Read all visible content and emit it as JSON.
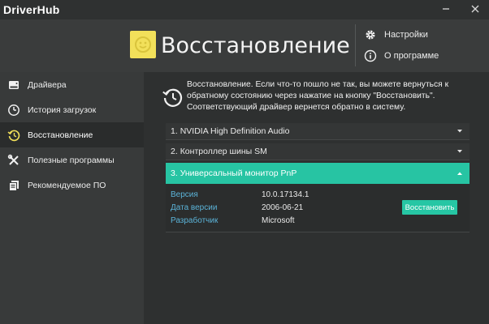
{
  "window": {
    "brand": "DriverHub",
    "minimize_icon": "minimize-icon",
    "close_icon": "close-icon"
  },
  "header": {
    "title": "Восстановление",
    "logo_icon": "smiley-logo-icon",
    "menu": [
      {
        "label": "Настройки",
        "icon": "gear-icon"
      },
      {
        "label": "О программе",
        "icon": "info-icon"
      }
    ]
  },
  "sidebar": {
    "items": [
      {
        "label": "Драйвера",
        "icon": "drive-icon",
        "active": false
      },
      {
        "label": "История загрузок",
        "icon": "clock-icon",
        "active": false
      },
      {
        "label": "Восстановление",
        "icon": "restore-icon",
        "active": true
      },
      {
        "label": "Полезные программы",
        "icon": "tools-icon",
        "active": false
      },
      {
        "label": "Рекомендуемое ПО",
        "icon": "software-icon",
        "active": false
      }
    ]
  },
  "main": {
    "info_icon": "restore-icon",
    "info_text": "Восстановление. Если что-то пошло не так, вы можете вернуться к обратному состоянию через нажатие на кнопку \"Восстановить\". Соответствующий драйвер вернется обратно в систему.",
    "drivers": [
      {
        "index": "1.",
        "name": "NVIDIA High Definition Audio",
        "expanded": false
      },
      {
        "index": "2.",
        "name": "Контроллер шины SM",
        "expanded": false
      },
      {
        "index": "3.",
        "name": "Универсальный монитор PnP",
        "expanded": true
      }
    ],
    "details": {
      "version_label": "Версия",
      "version_value": "10.0.17134.1",
      "date_label": "Дата версии",
      "date_value": "2006-06-21",
      "dev_label": "Разработчик",
      "dev_value": "Microsoft",
      "restore_button": "Восстановить"
    }
  },
  "colors": {
    "accent": "#27c4a3",
    "logo": "#f2e05a",
    "key_text": "#5bb3d8"
  }
}
